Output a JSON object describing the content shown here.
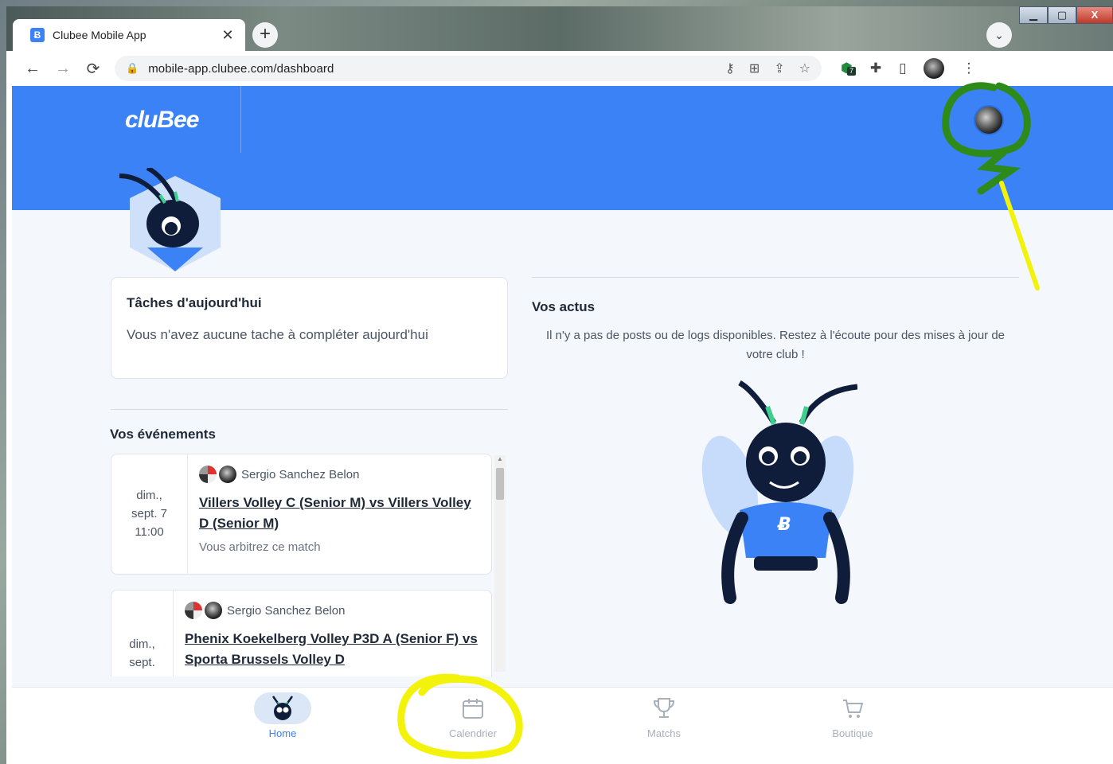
{
  "browser": {
    "tab_title": "Clubee Mobile App",
    "tab_favicon": "Ƀ",
    "close_glyph": "✕",
    "newtab_glyph": "+",
    "tabsearch_glyph": "⌄",
    "url": "mobile-app.clubee.com/dashboard",
    "extension_badge": "7",
    "window_controls": {
      "minimize": "▁",
      "maximize": "▢",
      "close": "X"
    },
    "icons": {
      "back": "←",
      "forward": "→",
      "reload": "⟳",
      "lock": "🔒",
      "key": "⚷",
      "translate": "⊞",
      "share": "⇪",
      "star": "☆",
      "puzzle": "✚",
      "sidepanel": "▯",
      "menu": "⋮"
    }
  },
  "header": {
    "logo_text": "cluBee"
  },
  "tasks": {
    "title": "Tâches d'aujourd'hui",
    "empty_text": "Vous n'avez aucune tache à compléter aujourd'hui"
  },
  "events": {
    "title": "Vos événements",
    "items": [
      {
        "date_line1": "dim.,",
        "date_line2": "sept. 7",
        "date_line3": "11:00",
        "organizer": "Sergio Sanchez Belon",
        "match": "Villers Volley C (Senior M) vs Villers Volley D (Senior M)",
        "role": "Vous arbitrez ce match"
      },
      {
        "date_line1": "dim.,",
        "date_line2": "sept.",
        "date_line3": "",
        "organizer": "Sergio Sanchez Belon",
        "match": "Phenix Koekelberg Volley P3D A (Senior F) vs Sporta Brussels Volley D",
        "role": ""
      }
    ]
  },
  "news": {
    "title": "Vos actus",
    "empty_text": "Il n'y a pas de posts ou de logs disponibles. Restez à l'écoute pour des mises à jour de votre club !"
  },
  "bottom_nav": {
    "items": [
      {
        "label": "Home",
        "icon": "bee-icon",
        "active": true
      },
      {
        "label": "Calendrier",
        "icon": "calendar-icon",
        "active": false
      },
      {
        "label": "Matchs",
        "icon": "trophy-icon",
        "active": false
      },
      {
        "label": "Boutique",
        "icon": "cart-icon",
        "active": false
      }
    ]
  },
  "colors": {
    "brand_blue": "#3b82f6",
    "mascot_navy": "#0f1d3a",
    "mascot_green": "#3ecf8e",
    "annotation_green": "#2e8b1a",
    "annotation_yellow": "#f2f20a"
  }
}
